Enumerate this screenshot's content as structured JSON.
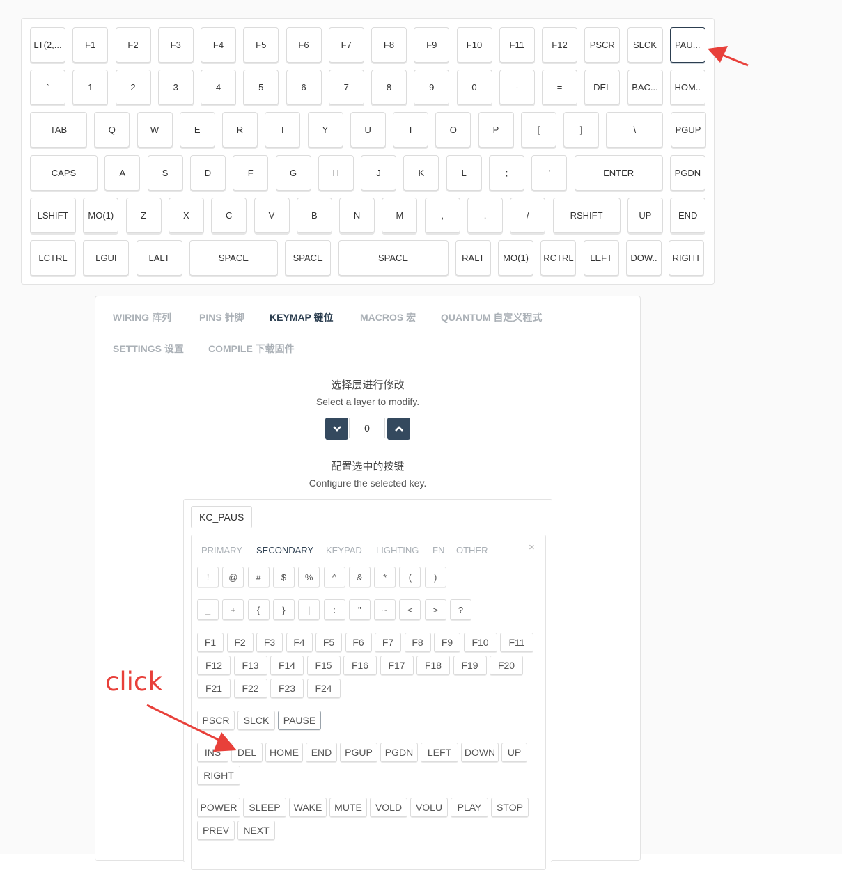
{
  "keyboard": {
    "rows": [
      [
        "LT(2,...",
        "F1",
        "F2",
        "F3",
        "F4",
        "F5",
        "F6",
        "F7",
        "F8",
        "F9",
        "F10",
        "F11",
        "F12",
        "PSCR",
        "SLCK",
        "PAU..."
      ],
      [
        "`",
        "1",
        "2",
        "3",
        "4",
        "5",
        "6",
        "7",
        "8",
        "9",
        "0",
        "-",
        "=",
        "DEL",
        "BAC...",
        "HOM.."
      ],
      [
        "TAB",
        "Q",
        "W",
        "E",
        "R",
        "T",
        "Y",
        "U",
        "I",
        "O",
        "P",
        "[",
        "]",
        "\\",
        "PGUP"
      ],
      [
        "CAPS",
        "A",
        "S",
        "D",
        "F",
        "G",
        "H",
        "J",
        "K",
        "L",
        ";",
        "'",
        "ENTER",
        "PGDN"
      ],
      [
        "LSHIFT",
        "MO(1)",
        "Z",
        "X",
        "C",
        "V",
        "B",
        "N",
        "M",
        ",",
        ".",
        "/",
        "RSHIFT",
        "UP",
        "END"
      ],
      [
        "LCTRL",
        "LGUI",
        "LALT",
        "SPACE",
        "SPACE",
        "SPACE",
        "RALT",
        "MO(1)",
        "RCTRL",
        "LEFT",
        "DOW..",
        "RIGHT"
      ]
    ],
    "selected_key": "PAU..."
  },
  "tabs": [
    "WIRING 阵列",
    "PINS 针脚",
    "KEYMAP 键位",
    "MACROS 宏",
    "QUANTUM 自定义程式",
    "SETTINGS 设置",
    "COMPILE 下载固件"
  ],
  "active_tab": "KEYMAP 键位",
  "layer": {
    "title_cn": "选择层进行修改",
    "title_en": "Select a layer to modify.",
    "value": "0"
  },
  "configure": {
    "title_cn": "配置选中的按键",
    "title_en": "Configure the selected key.",
    "current_code": "KC_PAUS"
  },
  "picker": {
    "tabs": [
      "PRIMARY",
      "SECONDARY",
      "KEYPAD",
      "LIGHTING",
      "FN",
      "OTHER"
    ],
    "active_tab": "SECONDARY",
    "close_symbol": "×",
    "symbols_row1": [
      "!",
      "@",
      "#",
      "$",
      "%",
      "^",
      "&",
      "*",
      "(",
      ")"
    ],
    "symbols_row2": [
      "_",
      "+",
      "{",
      "}",
      "|",
      ":",
      "\"",
      "~",
      "<",
      ">",
      "?"
    ],
    "function_keys": [
      "F1",
      "F2",
      "F3",
      "F4",
      "F5",
      "F6",
      "F7",
      "F8",
      "F9",
      "F10",
      "F11",
      "F12",
      "F13",
      "F14",
      "F15",
      "F16",
      "F17",
      "F18",
      "F19",
      "F20",
      "F21",
      "F22",
      "F23",
      "F24"
    ],
    "system_keys": [
      "PSCR",
      "SLCK",
      "PAUSE"
    ],
    "nav_keys": [
      "INS",
      "DEL",
      "HOME",
      "END",
      "PGUP",
      "PGDN",
      "LEFT",
      "DOWN",
      "UP",
      "RIGHT"
    ],
    "media_keys": [
      "POWER",
      "SLEEP",
      "WAKE",
      "MUTE",
      "VOLD",
      "VOLU",
      "PLAY",
      "STOP",
      "PREV",
      "NEXT"
    ],
    "selected_code": "PAUSE"
  },
  "annotation": {
    "text": "click",
    "color": "#e8403a"
  }
}
